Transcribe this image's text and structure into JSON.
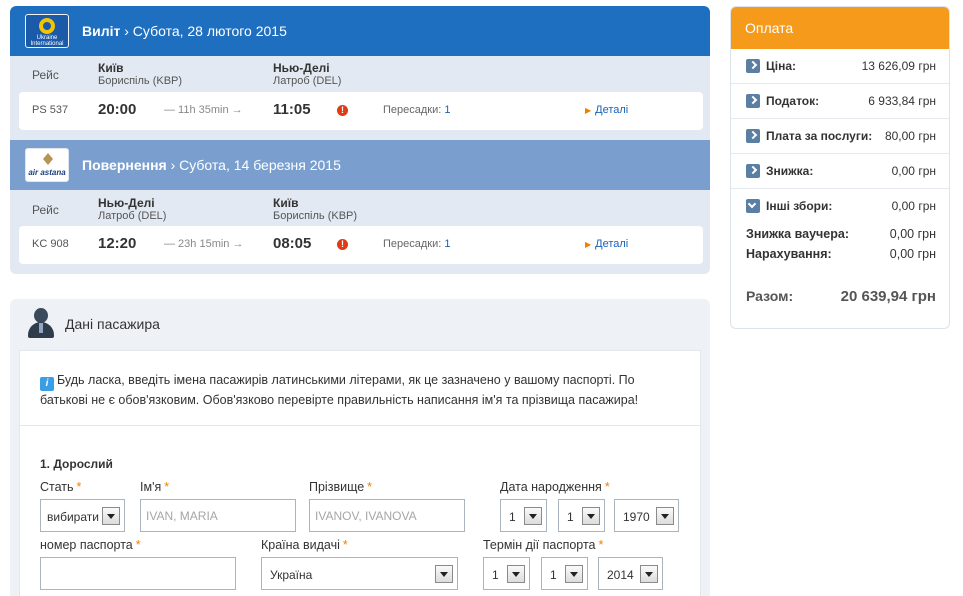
{
  "outbound": {
    "airline_logo_text": "Ukraine International",
    "title_bold": "Виліт",
    "title_date": "› Субота, 28 лютого 2015",
    "flight_label": "Рейс",
    "from_city": "Київ",
    "from_airport": "Бориспіль (KBP)",
    "to_city": "Нью-Делі",
    "to_airport": "Латроб (DEL)",
    "flight_no": "PS 537",
    "departure": "20:00",
    "duration": "— 11h 35min →",
    "arrival": "11:05",
    "stops_label": "Пересадки:",
    "stops_count": "1",
    "details": "Деталі"
  },
  "return": {
    "airline_logo_text": "air astana",
    "title_bold": "Повернення",
    "title_date": "› Субота, 14 березня 2015",
    "flight_label": "Рейс",
    "from_city": "Нью-Делі",
    "from_airport": "Латроб (DEL)",
    "to_city": "Київ",
    "to_airport": "Бориспіль (KBP)",
    "flight_no": "KC 908",
    "departure": "12:20",
    "duration": "— 23h 15min →",
    "arrival": "08:05",
    "stops_label": "Пересадки:",
    "stops_count": "1",
    "details": "Деталі"
  },
  "passenger": {
    "section_title": "Дані пасажира",
    "notice": "Будь ласка, введіть імена пасажирів латинськими літерами, як це зазначено у вашому паспорті. По батькові не є обов'язковим. Обов'язково перевірте правильність написання ім'я та прізвища пасажира!",
    "adult_title": "1. Дорослий",
    "required_mark": "*",
    "gender_label": "Стать",
    "gender_value": "вибирати",
    "first_name_label": "Ім'я",
    "first_name_placeholder": "IVAN, MARIA",
    "last_name_label": "Прізвище",
    "last_name_placeholder": "IVANOV, IVANOVA",
    "birth_label": "Дата народження",
    "birth_day": "1",
    "birth_month": "1",
    "birth_year": "1970",
    "passport_label": "номер паспорта",
    "passport_value": "",
    "country_label": "Країна видачі",
    "country_value": "Україна",
    "expiry_label": "Термін дії паспорта",
    "expiry_day": "1",
    "expiry_month": "1",
    "expiry_year": "2014"
  },
  "payment": {
    "title": "Оплата",
    "rows": [
      {
        "label": "Ціна:",
        "value": "13 626,09 грн"
      },
      {
        "label": "Податок:",
        "value": "6 933,84 грн"
      },
      {
        "label": "Плата за послуги:",
        "value": "80,00 грн"
      },
      {
        "label": "Знижка:",
        "value": "0,00 грн"
      },
      {
        "label": "Інші збори:",
        "value": "0,00 грн"
      }
    ],
    "voucher_label": "Знижка ваучера:",
    "voucher_value": "0,00 грн",
    "accrual_label": "Нарахування:",
    "accrual_value": "0,00 грн",
    "total_label": "Разом:",
    "total_value": "20 639,94 грн"
  },
  "colors": {
    "outbound_header": "#1f6fc0",
    "return_header": "#7a9fcf",
    "payment_header": "#f59a1b",
    "required": "#f07f00",
    "link": "#1a62b5"
  }
}
